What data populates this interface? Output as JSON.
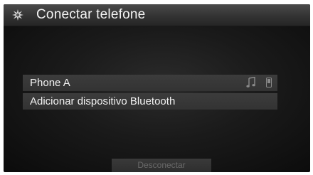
{
  "header": {
    "title": "Conectar telefone",
    "icon": "gear-sparkle-icon"
  },
  "devices": [
    {
      "label": "Phone A",
      "icons": [
        "music-note-icon",
        "phone-icon"
      ]
    },
    {
      "label": "Adicionar dispositivo Bluetooth"
    }
  ],
  "footer": {
    "disconnect_label": "Desconectar",
    "disconnect_state": "disabled"
  },
  "colors": {
    "background": "#1a1a1a",
    "header": "#333333",
    "row": "#383838",
    "text": "#f2f2f2",
    "disabled_text": "#6a6a6a"
  }
}
